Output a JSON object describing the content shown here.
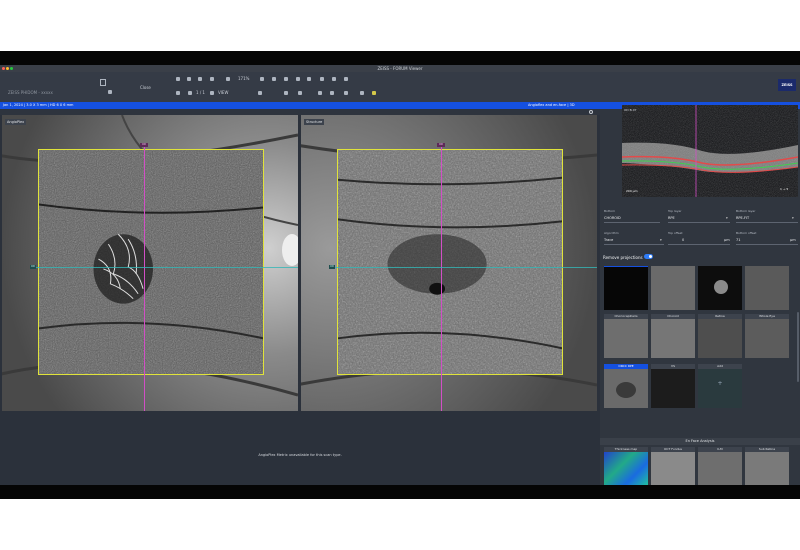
{
  "window": {
    "title": "ZEISS - FORUM Viewer",
    "logo": "ZEISS"
  },
  "toolbar": {
    "patient": "ZEISS PHIDOM - xxxxx",
    "btn_close": "Close",
    "zoom_level": "171%",
    "page_indicator": "1 / 1",
    "view_all": "VIEW"
  },
  "status_bar": {
    "scan_info": "Jan 1, 2024   |   3.0 X 3 mm   |   HD 6 X 6 mm",
    "layout_label": "Angioflex and en-face   |   3D"
  },
  "panels": {
    "left_label": "AngioPlex",
    "right_label": "Structure"
  },
  "viewer": {
    "message": "AngioPlex Metrix unavailable for this scan type."
  },
  "bscan": {
    "label": "OD B-07",
    "scale": "200 µm",
    "nav": "1 → 5"
  },
  "fields": {
    "row1": [
      {
        "label": "Bottom",
        "value": "CHOROID"
      },
      {
        "label": "Top layer",
        "value": "RPE"
      },
      {
        "label": "Bottom layer",
        "value": "RPE-FIT"
      }
    ],
    "row2": [
      {
        "label": "Algorithm",
        "value": "Trace"
      },
      {
        "label": "Top offset",
        "value": "0",
        "unit": "µm"
      },
      {
        "label": "Bottom offset",
        "value": "71",
        "unit": "µm"
      }
    ]
  },
  "projections": {
    "toggle_label": "Remove projections",
    "toggle_on": true
  },
  "thumbnails": [
    {
      "label": ""
    },
    {
      "label": ""
    },
    {
      "label": ""
    },
    {
      "label": ""
    },
    {
      "label": "Choriocapillaris"
    },
    {
      "label": "Choroid"
    },
    {
      "label": "Retina"
    },
    {
      "label": "Whole Eye"
    },
    {
      "label": "ORCC RPE",
      "selected": true
    },
    {
      "label": "VS"
    },
    {
      "label": "Add"
    }
  ],
  "en_face": {
    "title": "En Face Analysis",
    "thumbs": [
      {
        "label": "Thickness map"
      },
      {
        "label": "OCT Fundus"
      },
      {
        "label": "ILM"
      },
      {
        "label": "Sub Retina"
      }
    ]
  },
  "colors": {
    "accent": "#1550e0",
    "roi": "#e0e33a",
    "line_v": "#d24ec6",
    "line_h": "#35b7b7",
    "toggle": "#2f7cf6"
  }
}
